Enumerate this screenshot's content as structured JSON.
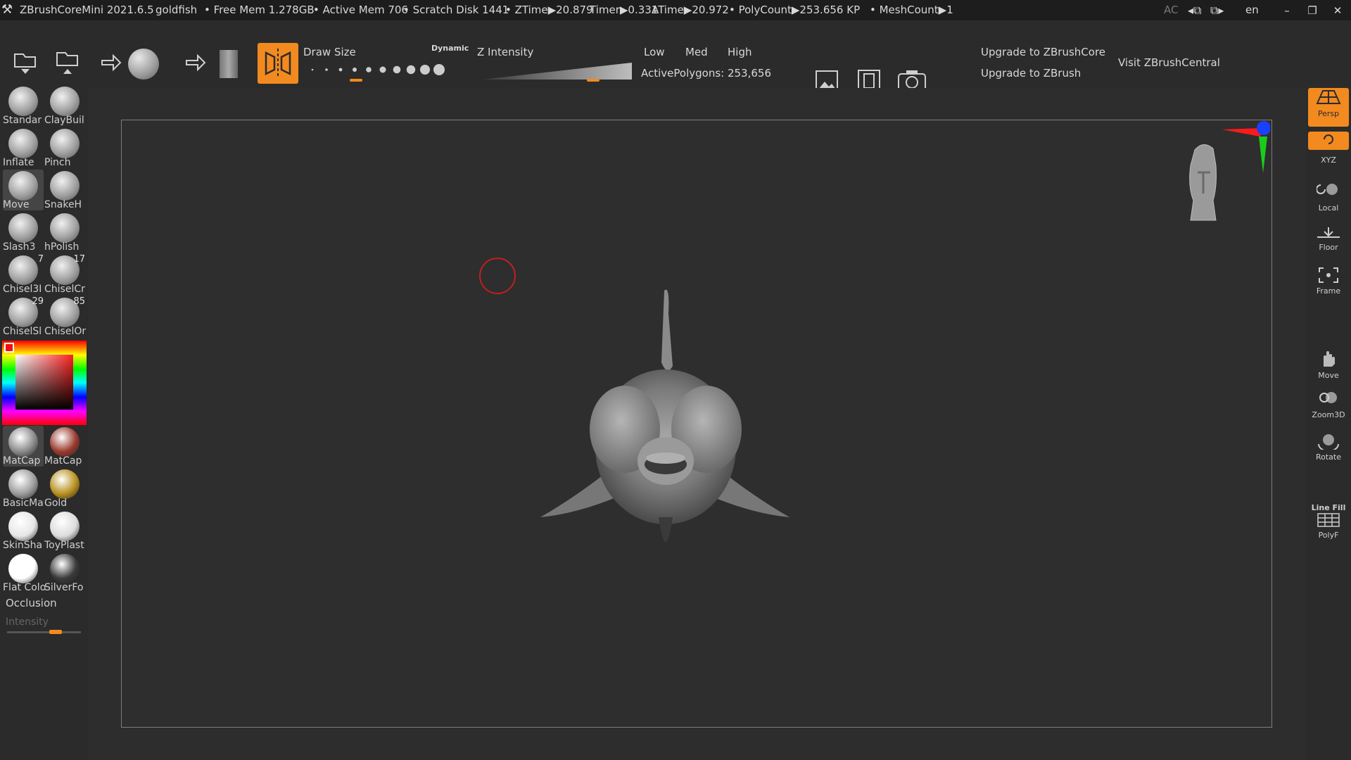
{
  "titlebar": {
    "app_name": "ZBrushCoreMini 2021.6.5",
    "document": "goldfish",
    "free_mem": "• Free Mem 1.278GB",
    "active_mem": "• Active Mem 706",
    "scratch_disk": "• Scratch Disk 1441",
    "ztime": "• ZTime▶20.879",
    "timer": "Timer▶0.331",
    "atime": "ATime▶20.972",
    "polycount": "• PolyCount▶253.656 KP",
    "meshcount": "• MeshCount▶1",
    "ac": "AC",
    "lang": "en",
    "minimize": "–",
    "restore": "❐",
    "close": "✕"
  },
  "toolbar": {
    "draw_size_label": "Draw Size",
    "dynamic_label": "Dynamic",
    "draw_size_level": 0.28,
    "z_intensity_label": "Z Intensity",
    "z_intensity_level": 0.72,
    "low": "Low",
    "med": "Med",
    "high": "High",
    "active_polygons": "ActivePolygons: 253,656",
    "upgrade_core": "Upgrade to ZBrushCore",
    "upgrade_zbrush": "Upgrade to ZBrush",
    "visit_central": "Visit ZBrushCentral"
  },
  "brushes": [
    {
      "name": "Standar",
      "num": ""
    },
    {
      "name": "ClayBuil",
      "num": ""
    },
    {
      "name": "Inflate",
      "num": ""
    },
    {
      "name": "Pinch",
      "num": ""
    },
    {
      "name": "Move",
      "num": ""
    },
    {
      "name": "SnakeH",
      "num": ""
    },
    {
      "name": "Slash3",
      "num": ""
    },
    {
      "name": "hPolish",
      "num": ""
    },
    {
      "name": "Chisel3I",
      "num": "7"
    },
    {
      "name": "ChiselCr",
      "num": "17"
    },
    {
      "name": "ChiselSl",
      "num": "29"
    },
    {
      "name": "ChiselOr",
      "num": "85"
    }
  ],
  "materials": [
    {
      "name": "MatCap",
      "color": "#8a8a8a"
    },
    {
      "name": "MatCap",
      "color": "#9a3a2e"
    },
    {
      "name": "BasicMa",
      "color": "#9c9c9c"
    },
    {
      "name": "Gold",
      "color": "#b8901e"
    },
    {
      "name": "SkinSha",
      "color": "#e6e6e6"
    },
    {
      "name": "ToyPlast",
      "color": "#dcdcdc"
    },
    {
      "name": "Flat Colo",
      "color": "#ffffff"
    },
    {
      "name": "SilverFo",
      "color": "#3a3a3a"
    }
  ],
  "occlusion": {
    "label": "Occlusion",
    "intensity_label": "Intensity",
    "intensity_level": 0.6
  },
  "right_shelf": {
    "persp": "Persp",
    "xyz": "XYZ",
    "local": "Local",
    "floor": "Floor",
    "frame": "Frame",
    "move": "Move",
    "zoom3d": "Zoom3D",
    "rotate": "Rotate",
    "linefill": "Line Fill",
    "polyf": "PolyF"
  },
  "colors": {
    "accent": "#f28a1f",
    "background": "#2e2e2e",
    "panel": "#2b2b2b"
  }
}
